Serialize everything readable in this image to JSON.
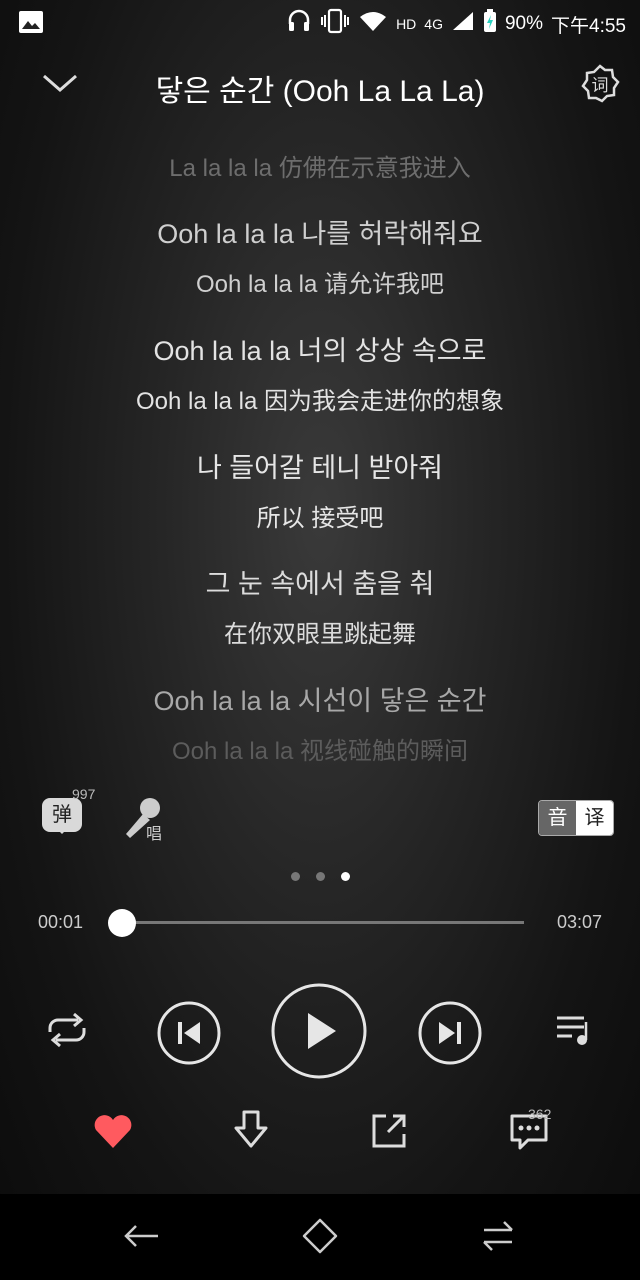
{
  "status": {
    "hd": "HD",
    "network": "4G",
    "battery": "90%",
    "time": "下午4:55"
  },
  "header": {
    "title": "닿은 순간 (Ooh La La La)"
  },
  "lyrics": [
    {
      "text": "La la la la 仿佛在示意我进入",
      "kind": "trans",
      "color": "#6d6d6d"
    },
    {
      "text": "Ooh la la la 나를 허락해줘요",
      "kind": "orig",
      "color": "#cfcfcf"
    },
    {
      "text": "Ooh la la la 请允许我吧",
      "kind": "trans",
      "color": "#cfcfcf"
    },
    {
      "text": "Ooh la la la 너의 상상 속으로",
      "kind": "orig",
      "color": "#e3e3e3"
    },
    {
      "text": "Ooh la la la 因为我会走进你的想象",
      "kind": "trans",
      "color": "#e3e3e3"
    },
    {
      "text": "나 들어갈 테니 받아줘",
      "kind": "orig",
      "color": "#e6e6e6"
    },
    {
      "text": "所以 接受吧",
      "kind": "trans",
      "color": "#e6e6e6"
    },
    {
      "text": "그 눈 속에서 춤을 춰",
      "kind": "orig",
      "color": "#dcdcdc"
    },
    {
      "text": "在你双眼里跳起舞",
      "kind": "trans",
      "color": "#dcdcdc"
    },
    {
      "text": "Ooh la la la 시선이 닿은 순간",
      "kind": "orig",
      "color": "#a8a8a8"
    },
    {
      "text": "Ooh la la la 视线碰触的瞬间",
      "kind": "trans",
      "color": "#5c5c5c"
    }
  ],
  "tools": {
    "danmu_label": "弹",
    "danmu_count": "997",
    "sing_label": "唱",
    "toggle_original": "音",
    "toggle_translate": "译"
  },
  "pager": {
    "count": 3,
    "active": 2
  },
  "playback": {
    "current": "00:01",
    "duration": "03:07",
    "progress_fraction": 0.009
  },
  "actions": {
    "comment_count": "362",
    "like_color": "#ff5a5f"
  },
  "icons": {
    "back": "chevron-down-icon",
    "lyrics_setting": "ci-lyrics-icon",
    "repeat": "repeat-icon",
    "previous": "previous-icon",
    "play": "play-icon",
    "next": "next-icon",
    "playlist": "playlist-icon",
    "like": "heart-icon",
    "download": "download-icon",
    "share": "share-icon",
    "comment": "comment-icon"
  }
}
